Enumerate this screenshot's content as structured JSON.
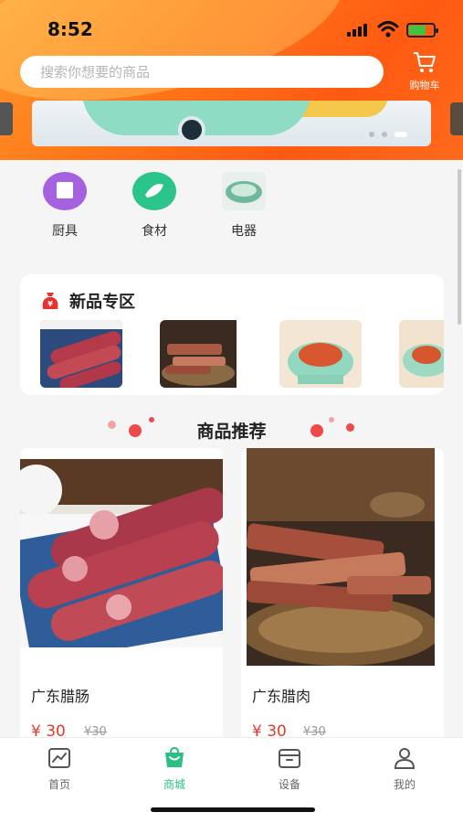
{
  "status": {
    "time": "8:52"
  },
  "search": {
    "placeholder": "搜索你想要的商品"
  },
  "cart": {
    "label": "购物车"
  },
  "categories": [
    {
      "label": "厨具",
      "icon": "kitchenware-icon",
      "color": "#a561e0"
    },
    {
      "label": "食材",
      "icon": "ingredients-icon",
      "color": "#2bc48a"
    },
    {
      "label": "电器",
      "icon": "appliance-icon",
      "color": "#6fb89b"
    }
  ],
  "new_section": {
    "title": "新品专区"
  },
  "recommend": {
    "title": "商品推荐"
  },
  "products": [
    {
      "name": "广东腊肠",
      "price": "¥ 30",
      "old_price": "¥30"
    },
    {
      "name": "广东腊肉",
      "price": "¥ 30",
      "old_price": "¥30"
    }
  ],
  "tabs": [
    {
      "label": "首页",
      "icon": "chart-icon"
    },
    {
      "label": "商城",
      "icon": "shopping-bag-icon"
    },
    {
      "label": "设备",
      "icon": "device-box-icon"
    },
    {
      "label": "我的",
      "icon": "user-icon"
    }
  ],
  "colors": {
    "accent": "#ff7a1a",
    "active_tab": "#2bbf86",
    "price": "#e83828"
  }
}
